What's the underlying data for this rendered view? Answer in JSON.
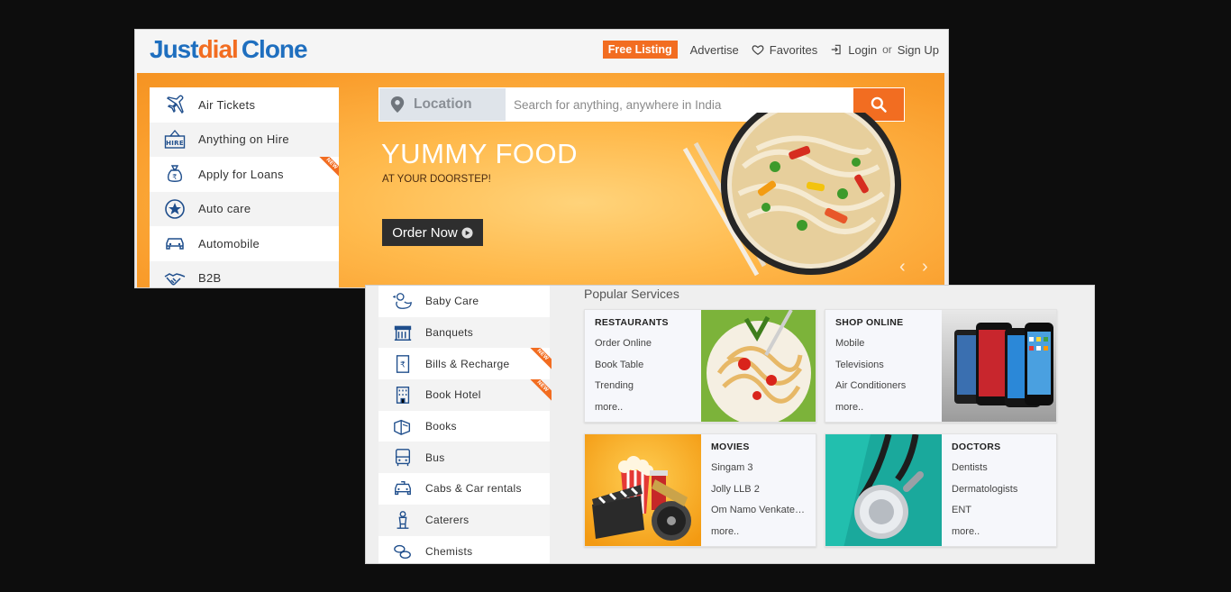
{
  "header": {
    "logo": {
      "part1": "Just",
      "part2": "dial",
      "part3": "Clone"
    },
    "free_listing": "Free Listing",
    "advertise": "Advertise",
    "favorites": "Favorites",
    "login": "Login",
    "or": "or",
    "signup": "Sign Up"
  },
  "sidebar_top": {
    "items": [
      {
        "label": "Air Tickets",
        "icon": "airplane-icon"
      },
      {
        "label": "Anything on Hire",
        "icon": "hire-icon"
      },
      {
        "label": "Apply for Loans",
        "icon": "rupee-bag-icon",
        "ribbon": "NEW"
      },
      {
        "label": "Auto care",
        "icon": "star-badge-icon"
      },
      {
        "label": "Automobile",
        "icon": "car-icon"
      },
      {
        "label": "B2B",
        "icon": "handshake-icon"
      }
    ]
  },
  "search": {
    "location_label": "Location",
    "placeholder": "Search for anything, anywhere in India"
  },
  "banner": {
    "title": "YUMMY FOOD",
    "subtitle": "AT YOUR DOORSTEP!",
    "button": "Order Now",
    "prev": "‹",
    "next": "›"
  },
  "sidebar_bottom": {
    "items": [
      {
        "label": "Baby Care",
        "icon": "baby-duck-icon"
      },
      {
        "label": "Banquets",
        "icon": "banquet-hall-icon"
      },
      {
        "label": "Bills & Recharge",
        "icon": "rupee-bill-icon",
        "ribbon": "NEW"
      },
      {
        "label": "Book Hotel",
        "icon": "hotel-building-icon",
        "ribbon": "NEW"
      },
      {
        "label": "Books",
        "icon": "books-icon"
      },
      {
        "label": "Bus",
        "icon": "bus-icon"
      },
      {
        "label": "Cabs & Car rentals",
        "icon": "cab-icon"
      },
      {
        "label": "Caterers",
        "icon": "caterer-icon"
      },
      {
        "label": "Chemists",
        "icon": "pills-icon"
      }
    ]
  },
  "popular": {
    "title": "Popular Services",
    "cards": [
      {
        "title": "RESTAURANTS",
        "links": [
          "Order Online",
          "Book Table",
          "Trending",
          "more.."
        ]
      },
      {
        "title": "SHOP ONLINE",
        "links": [
          "Mobile",
          "Televisions",
          "Air Conditioners",
          "more.."
        ]
      },
      {
        "title": "MOVIES",
        "links": [
          "Singam 3",
          "Jolly LLB 2",
          "Om Namo Venkatesaya",
          "more.."
        ]
      },
      {
        "title": "DOCTORS",
        "links": [
          "Dentists",
          "Dermatologists",
          "ENT",
          "more.."
        ]
      }
    ]
  },
  "colors": {
    "brand_blue": "#1f6fbf",
    "brand_orange": "#f26d21",
    "banner_orange": "#f99c2b"
  }
}
